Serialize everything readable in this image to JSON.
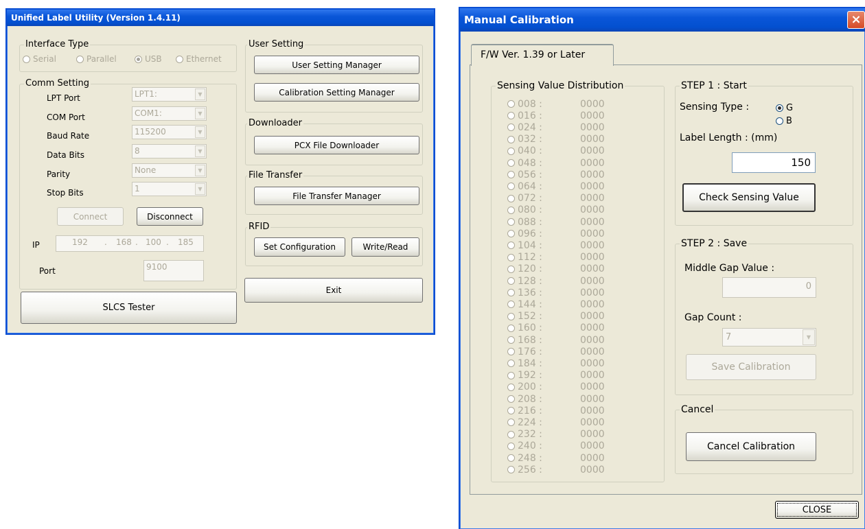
{
  "left": {
    "title": "Unified Label Utility  (Version 1.4.11)",
    "interface_type": {
      "legend": "Interface Type",
      "options": [
        {
          "label": "Serial",
          "checked": false
        },
        {
          "label": "Parallel",
          "checked": false
        },
        {
          "label": "USB",
          "checked": true
        },
        {
          "label": "Ethernet",
          "checked": false
        }
      ]
    },
    "comm_setting": {
      "legend": "Comm Setting",
      "rows": [
        {
          "label": "LPT Port",
          "value": "LPT1:"
        },
        {
          "label": "COM Port",
          "value": "COM1:"
        },
        {
          "label": "Baud Rate",
          "value": "115200"
        },
        {
          "label": "Data Bits",
          "value": "8"
        },
        {
          "label": "Parity",
          "value": "None"
        },
        {
          "label": "Stop Bits",
          "value": "1"
        }
      ],
      "connect": "Connect",
      "disconnect": "Disconnect",
      "ip_label": "IP",
      "ip": [
        "192",
        "168",
        "100",
        "185"
      ],
      "ip_dot": ".",
      "port_label": "Port",
      "port": "9100"
    },
    "user_setting": {
      "legend": "User Setting",
      "user_manager": "User Setting Manager",
      "calib_manager": "Calibration Setting Manager"
    },
    "downloader": {
      "legend": "Downloader",
      "pcx": "PCX File Downloader"
    },
    "file_transfer": {
      "legend": "File Transfer",
      "manager": "File Transfer Manager"
    },
    "rfid": {
      "legend": "RFID",
      "set_config": "Set Configuration",
      "write_read": "Write/Read"
    },
    "exit": "Exit",
    "slcs": "SLCS Tester"
  },
  "right": {
    "title": "Manual Calibration",
    "close_icon": "×",
    "tab": "F/W Ver. 1.39 or Later",
    "distribution": {
      "legend": "Sensing Value Distribution",
      "rows": [
        {
          "label": "008 :",
          "value": "0000"
        },
        {
          "label": "016 :",
          "value": "0000"
        },
        {
          "label": "024 :",
          "value": "0000"
        },
        {
          "label": "032 :",
          "value": "0000"
        },
        {
          "label": "040 :",
          "value": "0000"
        },
        {
          "label": "048 :",
          "value": "0000"
        },
        {
          "label": "056 :",
          "value": "0000"
        },
        {
          "label": "064 :",
          "value": "0000"
        },
        {
          "label": "072 :",
          "value": "0000"
        },
        {
          "label": "080 :",
          "value": "0000"
        },
        {
          "label": "088 :",
          "value": "0000"
        },
        {
          "label": "096 :",
          "value": "0000"
        },
        {
          "label": "104 :",
          "value": "0000"
        },
        {
          "label": "112 :",
          "value": "0000"
        },
        {
          "label": "120 :",
          "value": "0000"
        },
        {
          "label": "128 :",
          "value": "0000"
        },
        {
          "label": "136 :",
          "value": "0000"
        },
        {
          "label": "144 :",
          "value": "0000"
        },
        {
          "label": "152 :",
          "value": "0000"
        },
        {
          "label": "160 :",
          "value": "0000"
        },
        {
          "label": "168 :",
          "value": "0000"
        },
        {
          "label": "176 :",
          "value": "0000"
        },
        {
          "label": "184 :",
          "value": "0000"
        },
        {
          "label": "192 :",
          "value": "0000"
        },
        {
          "label": "200 :",
          "value": "0000"
        },
        {
          "label": "208 :",
          "value": "0000"
        },
        {
          "label": "216 :",
          "value": "0000"
        },
        {
          "label": "224 :",
          "value": "0000"
        },
        {
          "label": "232 :",
          "value": "0000"
        },
        {
          "label": "240 :",
          "value": "0000"
        },
        {
          "label": "248 :",
          "value": "0000"
        },
        {
          "label": "256 :",
          "value": "0000"
        }
      ]
    },
    "step1": {
      "legend": "STEP 1 : Start",
      "sensing_type_label": "Sensing Type :",
      "opt_g": "G",
      "opt_b": "B",
      "selected": "G",
      "label_length_label": "Label Length : (mm)",
      "label_length": "150",
      "check_button": "Check Sensing Value"
    },
    "step2": {
      "legend": "STEP 2 : Save",
      "middle_gap_label": "Middle Gap Value :",
      "middle_gap": "0",
      "gap_count_label": "Gap Count :",
      "gap_count": "7",
      "save_button": "Save Calibration"
    },
    "cancel": {
      "legend": "Cancel",
      "button": "Cancel Calibration"
    },
    "close_button": "CLOSE"
  }
}
